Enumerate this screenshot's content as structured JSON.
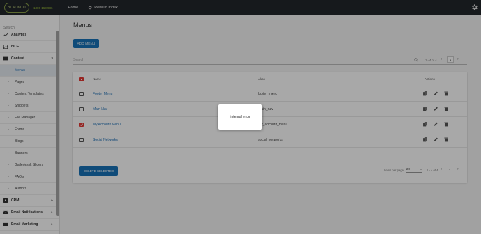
{
  "topbar": {
    "logo_text": "BLACKCO",
    "phone": "1300 163 986",
    "home": "Home",
    "rebuild": "Rebuild Index"
  },
  "sidebar": {
    "search_placeholder": "Search",
    "items": [
      {
        "label": "Analytics",
        "icon": "trending-up-icon"
      },
      {
        "label": "nICE",
        "icon": "image-icon"
      },
      {
        "label": "Content",
        "icon": "content-icon",
        "caret": "▾"
      }
    ],
    "sub_items": [
      {
        "label": "Menus",
        "active": true
      },
      {
        "label": "Pages"
      },
      {
        "label": "Content Templates"
      },
      {
        "label": "Snippets"
      },
      {
        "label": "File Manager"
      },
      {
        "label": "Forms"
      },
      {
        "label": "Blogs"
      },
      {
        "label": "Banners"
      },
      {
        "label": "Galleries & Sliders"
      },
      {
        "label": "FAQ's"
      },
      {
        "label": "Authors"
      }
    ],
    "bottom_items": [
      {
        "label": "CRM",
        "icon": "crm-icon",
        "caret": "▸"
      },
      {
        "label": "Email Notifications",
        "icon": "email-icon",
        "caret": "▸"
      },
      {
        "label": "Email Marketing",
        "icon": "email-marketing-icon",
        "caret": "▸"
      }
    ]
  },
  "main": {
    "title": "Menus",
    "add_button": "ADD MENU",
    "search_placeholder": "Search",
    "pager_text": "1 - 4 of 4",
    "page_number": "1",
    "columns": {
      "name": "Name",
      "alias": "Alias",
      "actions": "Actions"
    },
    "rows": [
      {
        "name": "Footer Menu",
        "alias": "footer_menu",
        "checked": false
      },
      {
        "name": "Main Nav",
        "alias": "main_nav",
        "checked": false
      },
      {
        "name": "My Account Menu",
        "alias": "my_account_menu",
        "checked": true
      },
      {
        "name": "Social Networks",
        "alias": "social_networks",
        "checked": false
      }
    ],
    "delete_button": "DELETE SELECTED",
    "items_per_page_label": "Items per page:",
    "items_per_page_value": "20",
    "footer_pager_text": "1 - 4 of 4",
    "footer_page_number": "1"
  },
  "modal": {
    "message": "internal error"
  },
  "colors": {
    "primary": "#1873b8",
    "checkbox": "#e53935",
    "topbar": "#22262b",
    "link": "#1e6fb5"
  }
}
